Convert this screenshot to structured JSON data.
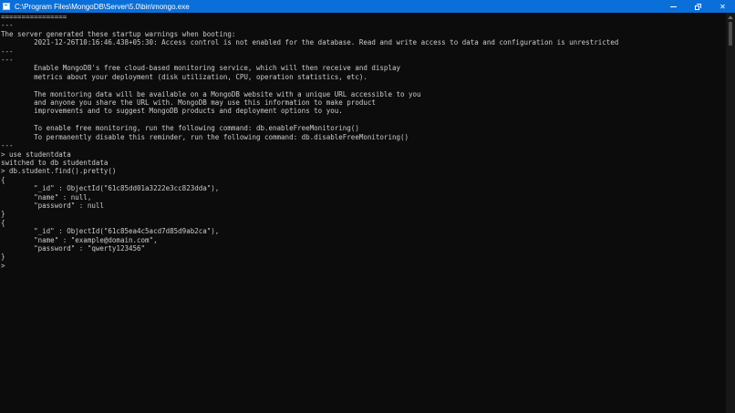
{
  "window": {
    "title": "C:\\Program Files\\MongoDB\\Server\\5.0\\bin\\mongo.exe",
    "minimize_glyph": "—",
    "maximize_glyph": "❐",
    "close_glyph": "✕",
    "titlebar_color": "#0a6fd8",
    "console_background": "#0c0c0c",
    "console_text_color": "#cccccc"
  },
  "console": {
    "lines": [
      "================",
      "---",
      "The server generated these startup warnings when booting:",
      "        2021-12-26T10:16:46.438+05:30: Access control is not enabled for the database. Read and write access to data and configuration is unrestricted",
      "---",
      "---",
      "        Enable MongoDB's free cloud-based monitoring service, which will then receive and display",
      "        metrics about your deployment (disk utilization, CPU, operation statistics, etc).",
      "",
      "        The monitoring data will be available on a MongoDB website with a unique URL accessible to you",
      "        and anyone you share the URL with. MongoDB may use this information to make product",
      "        improvements and to suggest MongoDB products and deployment options to you.",
      "",
      "        To enable free monitoring, run the following command: db.enableFreeMonitoring()",
      "        To permanently disable this reminder, run the following command: db.disableFreeMonitoring()",
      "---",
      "> use studentdata",
      "switched to db studentdata",
      "> db.student.find().pretty()",
      "{",
      "        \"_id\" : ObjectId(\"61c85dd01a3222e3cc823dda\"),",
      "        \"name\" : null,",
      "        \"password\" : null",
      "}",
      "{",
      "        \"_id\" : ObjectId(\"61c85ea4c5acd7d85d9ab2ca\"),",
      "        \"name\" : \"example@domain.com\",",
      "        \"password\" : \"qwerty123456\"",
      "}",
      ">"
    ]
  }
}
